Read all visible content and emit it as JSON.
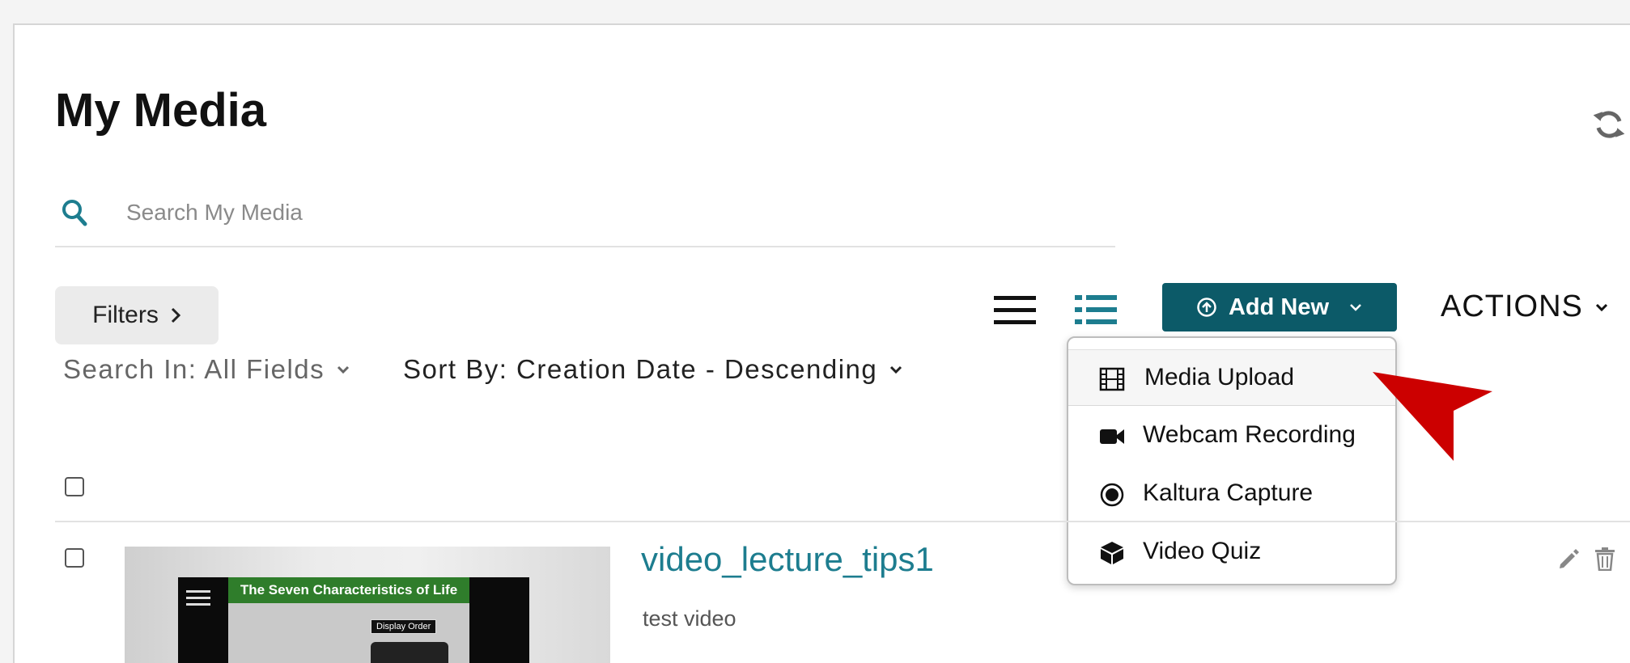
{
  "page": {
    "title": "My Media"
  },
  "search": {
    "placeholder": "Search My Media",
    "value": ""
  },
  "toolbar": {
    "filters_label": "Filters",
    "search_in_label": "Search In: All Fields",
    "sort_by_label": "Sort By: Creation Date - Descending",
    "add_new_label": "Add New",
    "actions_label": "ACTIONS"
  },
  "add_new_menu": {
    "items": [
      {
        "label": "Media Upload",
        "icon": "film-icon",
        "highlighted": true
      },
      {
        "label": "Webcam Recording",
        "icon": "video-camera-icon"
      },
      {
        "label": "Kaltura Capture",
        "icon": "record-icon"
      },
      {
        "label": "Video Quiz",
        "icon": "cube-icon"
      }
    ]
  },
  "media_list": [
    {
      "title": "video_lecture_tips1",
      "description": "test video",
      "thumbnail": {
        "slide_title": "The Seven Characteristics of Life",
        "button_text": "Display Order"
      }
    }
  ],
  "colors": {
    "accent": "#0c5a68",
    "link": "#1d7d8f",
    "arrow": "#cc0000",
    "search_icon": "#1d7d8f"
  }
}
